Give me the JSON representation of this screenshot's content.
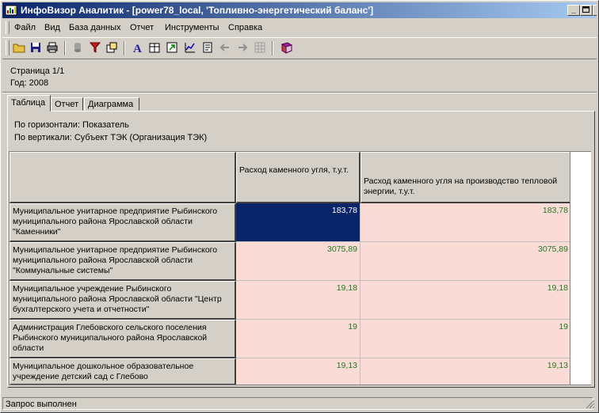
{
  "window": {
    "title": "ИнфоВизор Аналитик - [power78_local, 'Топливно-энергетический баланс']"
  },
  "menu": [
    "Файл",
    "Вид",
    "База данных",
    "Отчет",
    "Инструменты",
    "Справка"
  ],
  "toolbar_icons": [
    "open-folder-icon",
    "save-icon",
    "print-icon",
    "database-icon",
    "filter-icon",
    "pivot-icon",
    "font-icon",
    "table-icon",
    "export-icon",
    "chart-icon",
    "report-icon",
    "back-arrow-icon",
    "forward-arrow-icon",
    "grid-icon",
    "book-icon"
  ],
  "info": {
    "page": "Страница 1/1",
    "year": "Год: 2008"
  },
  "tabs": [
    {
      "label": "Таблица",
      "active": true
    },
    {
      "label": "Отчет",
      "active": false
    },
    {
      "label": "Диаграмма",
      "active": false
    }
  ],
  "axes": {
    "horizontal": "По горизонтали: Показатель",
    "vertical": "По вертикали: Субъект ТЭК (Организация ТЭК)"
  },
  "table": {
    "columns": [
      "Расход каменного угля,  т.у.т.",
      "Расход каменного угля на производство тепловой энергии,  т.у.т."
    ],
    "rows": [
      {
        "label": "Муниципальное унитарное предприятие Рыбинского муниципального района Ярославской области \"Каменники\"",
        "values": [
          "183,78",
          "183,78"
        ]
      },
      {
        "label": "Муниципальное унитарное предприятие Рыбинского муниципального района Ярославской области \"Коммунальные системы\"",
        "values": [
          "3075,89",
          "3075,89"
        ]
      },
      {
        "label": "Муниципальное учреждение Рыбинского муниципального района Ярославской области \"Центр бухгалтерского учета и отчетности\"",
        "values": [
          "19,18",
          "19,18"
        ]
      },
      {
        "label": "Администрация Глебовского сельского поселения Рыбинского муниципального района Ярославской области",
        "values": [
          "19",
          "19"
        ]
      },
      {
        "label": "Муниципальное дошкольное образовательное учреждение детский сад с Глебово",
        "values": [
          "19,13",
          "19,13"
        ]
      }
    ]
  },
  "status": "Запрос выполнен",
  "colors": {
    "title_start": "#0a246a",
    "title_end": "#a6caf0",
    "cell_bg": "#fadbd6",
    "value_text": "#207a20",
    "selected_bg": "#0a246a"
  }
}
